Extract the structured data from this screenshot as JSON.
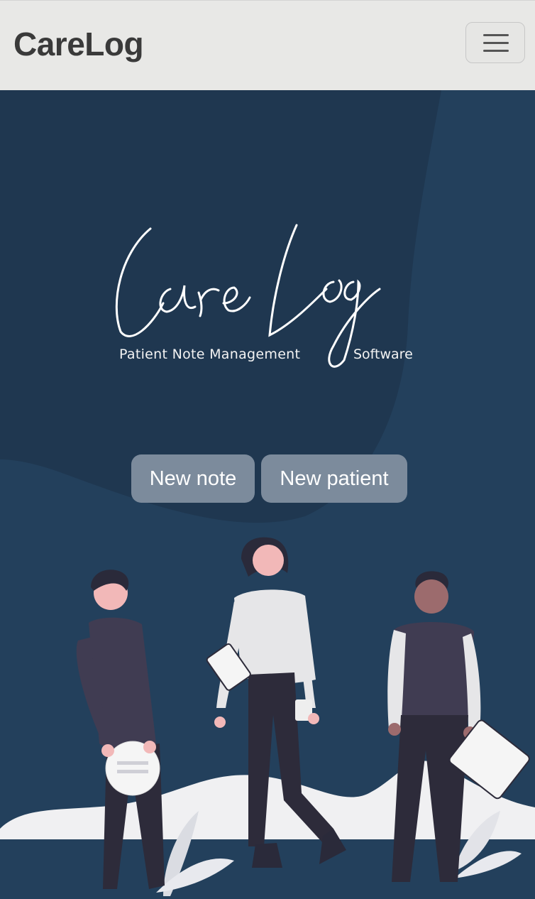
{
  "navbar": {
    "brand": "CareLog",
    "menu_icon": "hamburger-menu-icon"
  },
  "hero": {
    "logo_script": "CareLog",
    "logo_subtitle_left": "Patient Note Management",
    "logo_subtitle_right": "Software",
    "buttons": [
      {
        "label": "New note"
      },
      {
        "label": "New patient"
      }
    ]
  },
  "colors": {
    "navbar_bg": "#e8e8e6",
    "hero_bg": "#23405c",
    "hero_dark": "#1f3750",
    "button_bg": "#7c8b9c"
  }
}
